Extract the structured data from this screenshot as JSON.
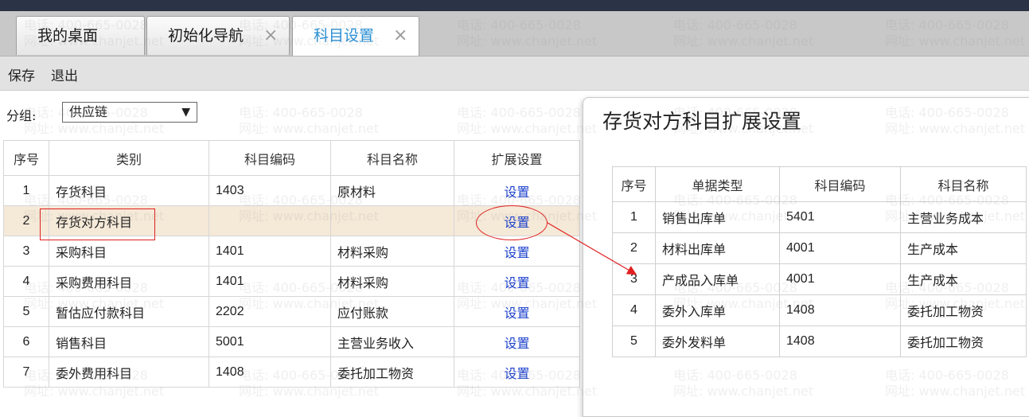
{
  "tabs": [
    {
      "label": "我的桌面",
      "closable": false,
      "active": false
    },
    {
      "label": "初始化导航",
      "closable": true,
      "active": false
    },
    {
      "label": "科目设置",
      "closable": true,
      "active": true
    }
  ],
  "close_glyph": "×",
  "toolbar": {
    "save_label": "保存",
    "exit_label": "退出"
  },
  "group": {
    "label": "分组:",
    "selected": "供应链",
    "arrow": "▼"
  },
  "main_table": {
    "headers": [
      "序号",
      "类别",
      "科目编码",
      "科目名称",
      "扩展设置"
    ],
    "rows": [
      {
        "no": "1",
        "category": "存货科目",
        "code": "1403",
        "name": "原材料",
        "action": "设置"
      },
      {
        "no": "2",
        "category": "存货对方科目",
        "code": "",
        "name": "",
        "action": "设置"
      },
      {
        "no": "3",
        "category": "采购科目",
        "code": "1401",
        "name": "材料采购",
        "action": "设置"
      },
      {
        "no": "4",
        "category": "采购费用科目",
        "code": "1401",
        "name": "材料采购",
        "action": "设置"
      },
      {
        "no": "5",
        "category": "暂估应付款科目",
        "code": "2202",
        "name": "应付账款",
        "action": "设置"
      },
      {
        "no": "6",
        "category": "销售科目",
        "code": "5001",
        "name": "主营业务收入",
        "action": "设置"
      },
      {
        "no": "7",
        "category": "委外费用科目",
        "code": "1408",
        "name": "委托加工物资",
        "action": "设置"
      }
    ],
    "selected_row": 1
  },
  "dialog": {
    "title": "存货对方科目扩展设置",
    "headers": [
      "序号",
      "单据类型",
      "科目编码",
      "科目名称"
    ],
    "rows": [
      {
        "no": "1",
        "doc_type": "销售出库单",
        "code": "5401",
        "name": "主营业务成本"
      },
      {
        "no": "2",
        "doc_type": "材料出库单",
        "code": "4001",
        "name": "生产成本"
      },
      {
        "no": "3",
        "doc_type": "产成品入库单",
        "code": "4001",
        "name": "生产成本"
      },
      {
        "no": "4",
        "doc_type": "委外入库单",
        "code": "1408",
        "name": "委托加工物资"
      },
      {
        "no": "5",
        "doc_type": "委外发料单",
        "code": "1408",
        "name": "委托加工物资"
      }
    ]
  },
  "watermark": {
    "phone": "电话: 400-665-0028",
    "site": "网址: www.chanjet.net"
  },
  "colors": {
    "accent_tab": "#2a8fd4",
    "link": "#1a3fcc",
    "highlight": "#e02020",
    "selected_row": "#f5e9d8"
  }
}
